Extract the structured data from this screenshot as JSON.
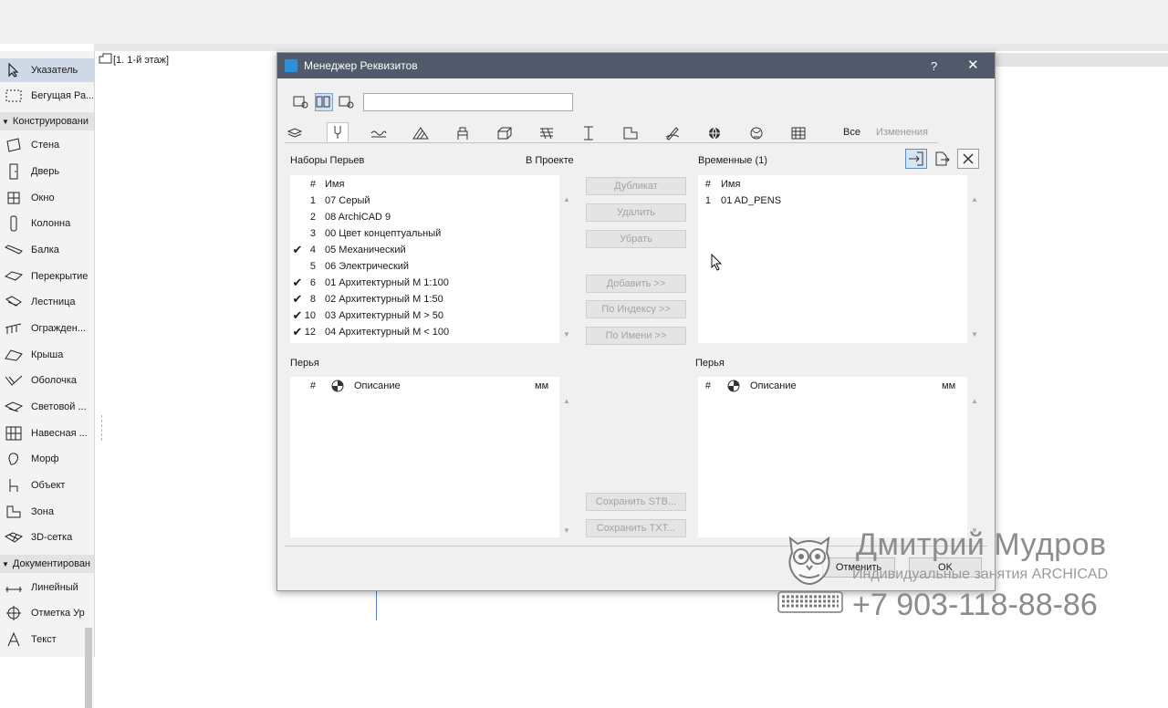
{
  "toolbox": {
    "items": [
      {
        "label": "Указатель",
        "icon": "arrow-pointer-icon",
        "selected": true
      },
      {
        "label": "Бегущая Ра...",
        "icon": "marquee-icon"
      }
    ],
    "section1": "Конструировани",
    "design_items": [
      {
        "label": "Стена",
        "icon": "wall-icon"
      },
      {
        "label": "Дверь",
        "icon": "door-icon"
      },
      {
        "label": "Окно",
        "icon": "window-icon"
      },
      {
        "label": "Колонна",
        "icon": "column-icon"
      },
      {
        "label": "Балка",
        "icon": "beam-icon"
      },
      {
        "label": "Перекрытие",
        "icon": "slab-icon"
      },
      {
        "label": "Лестница",
        "icon": "stair-icon"
      },
      {
        "label": "Огражден...",
        "icon": "railing-icon"
      },
      {
        "label": "Крыша",
        "icon": "roof-icon"
      },
      {
        "label": "Оболочка",
        "icon": "shell-icon"
      },
      {
        "label": "Световой ...",
        "icon": "skylight-icon"
      },
      {
        "label": "Навесная ...",
        "icon": "curtain-wall-icon"
      },
      {
        "label": "Морф",
        "icon": "morph-icon"
      },
      {
        "label": "Объект",
        "icon": "object-icon"
      },
      {
        "label": "Зона",
        "icon": "zone-icon"
      },
      {
        "label": "3D-сетка",
        "icon": "mesh-icon"
      }
    ],
    "section2": "Документирован",
    "doc_items": [
      {
        "label": "Линейный",
        "icon": "linear-dimension-icon"
      },
      {
        "label": "Отметка Ур",
        "icon": "level-dimension-icon"
      },
      {
        "label": "Текст",
        "icon": "text-icon"
      }
    ]
  },
  "floor_tab": "[1. 1-й этаж]",
  "dialog": {
    "title": "Менеджер Реквизитов",
    "help": "?",
    "close": "✕",
    "search_value": "",
    "tabs_all": "Все",
    "tabs_changes": "Изменения",
    "left_header": "Наборы Перьев",
    "left_header_right": "В Проекте",
    "col_num": "#",
    "col_name": "Имя",
    "penset_rows": [
      {
        "num": "1",
        "name": "07 Серый",
        "checked": false
      },
      {
        "num": "2",
        "name": "08 ArchiCAD 9",
        "checked": false
      },
      {
        "num": "3",
        "name": "00 Цвет концептуальный",
        "checked": false
      },
      {
        "num": "4",
        "name": "05 Механический",
        "checked": true
      },
      {
        "num": "5",
        "name": "06 Электрический",
        "checked": false
      },
      {
        "num": "6",
        "name": "01 Архитектурный М 1:100",
        "checked": true
      },
      {
        "num": "8",
        "name": "02 Архитектурный М 1:50",
        "checked": true
      },
      {
        "num": "10",
        "name": "03 Архитектурный М > 50",
        "checked": true
      },
      {
        "num": "12",
        "name": "04 Архитектурный М < 100",
        "checked": true
      }
    ],
    "buttons": {
      "duplicate": "Дубликат",
      "delete": "Удалить",
      "remove": "Убрать",
      "add": "Добавить >>",
      "by_index": "По Индексу >>",
      "by_name": "По Имени >>",
      "save_stb": "Сохранить STB...",
      "save_txt": "Сохранить TXT..."
    },
    "right_header": "Временные (1)",
    "temp_rows": [
      {
        "num": "1",
        "name": "01  AD_PENS"
      }
    ],
    "pens_left_header": "Перья",
    "pens_right_header": "Перья",
    "pens_col_num": "#",
    "pens_col_desc": "Описание",
    "pens_col_mm": "мм",
    "cancel": "Отменить",
    "ok": "OK"
  },
  "watermark": {
    "name": "Дмитрий Мудров",
    "subtitle": "Индивидуальные занятия ARCHICAD",
    "phone": "+7 903-118-88-86"
  }
}
